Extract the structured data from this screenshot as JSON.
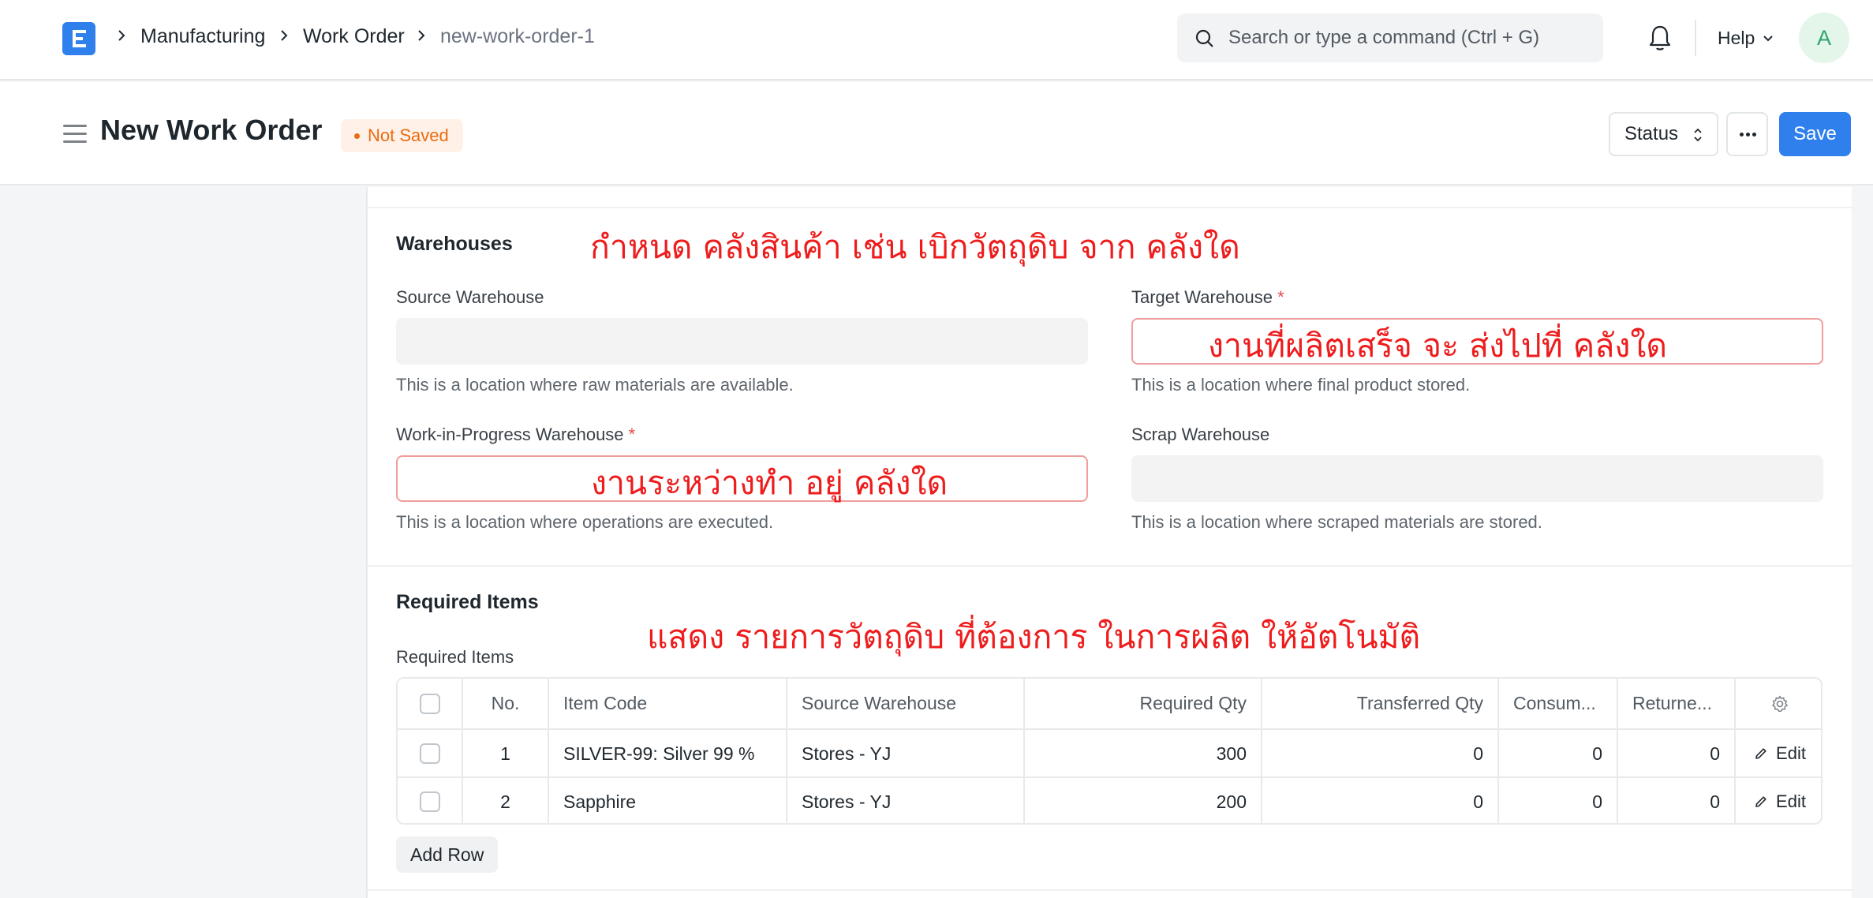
{
  "navbar": {
    "breadcrumbs": [
      "Manufacturing",
      "Work Order",
      "new-work-order-1"
    ],
    "search_placeholder": "Search or type a command (Ctrl + G)",
    "help_label": "Help",
    "avatar_initial": "A"
  },
  "header": {
    "title": "New Work Order",
    "status_badge": "Not Saved",
    "status_button": "Status",
    "save_button": "Save"
  },
  "warehouses": {
    "section_title": "Warehouses",
    "source": {
      "label": "Source Warehouse",
      "value": "",
      "description": "This is a location where raw materials are available."
    },
    "target": {
      "label": "Target Warehouse",
      "required": "*",
      "value": "",
      "description": "This is a location where final product stored."
    },
    "wip": {
      "label": "Work-in-Progress Warehouse",
      "required": "*",
      "value": "",
      "description": "This is a location where operations are executed."
    },
    "scrap": {
      "label": "Scrap Warehouse",
      "value": "",
      "description": "This is a location where scraped materials are stored."
    }
  },
  "required_items": {
    "section_title": "Required Items",
    "table_label": "Required Items",
    "columns": [
      "No.",
      "Item Code",
      "Source Warehouse",
      "Required Qty",
      "Transferred Qty",
      "Consum...",
      "Returne..."
    ],
    "rows": [
      {
        "no": "1",
        "item_code": "SILVER-99: Silver 99 %",
        "source_warehouse": "Stores - YJ",
        "required_qty": "300",
        "transferred_qty": "0",
        "consumed": "0",
        "returned": "0",
        "action": "Edit"
      },
      {
        "no": "2",
        "item_code": "Sapphire",
        "source_warehouse": "Stores - YJ",
        "required_qty": "200",
        "transferred_qty": "0",
        "consumed": "0",
        "returned": "0",
        "action": "Edit"
      }
    ],
    "add_row": "Add Row"
  },
  "annotations": {
    "warehouses_note": "กำหนด คลังสินค้า เช่น เบิกวัตถุดิบ จาก คลังใด",
    "target_note": "งานที่ผลิตเสร็จ จะ ส่งไปที่ คลังใด",
    "wip_note": "งานระหว่างทำ อยู่ คลังใด",
    "items_note": "แสดง รายการวัตถุดิบ ที่ต้องการ ในการผลิต ให้อัตโนมัติ"
  },
  "colors": {
    "accent": "#2f80ed",
    "annotation": "#ee1c1c",
    "not_saved": "#e86c13"
  }
}
